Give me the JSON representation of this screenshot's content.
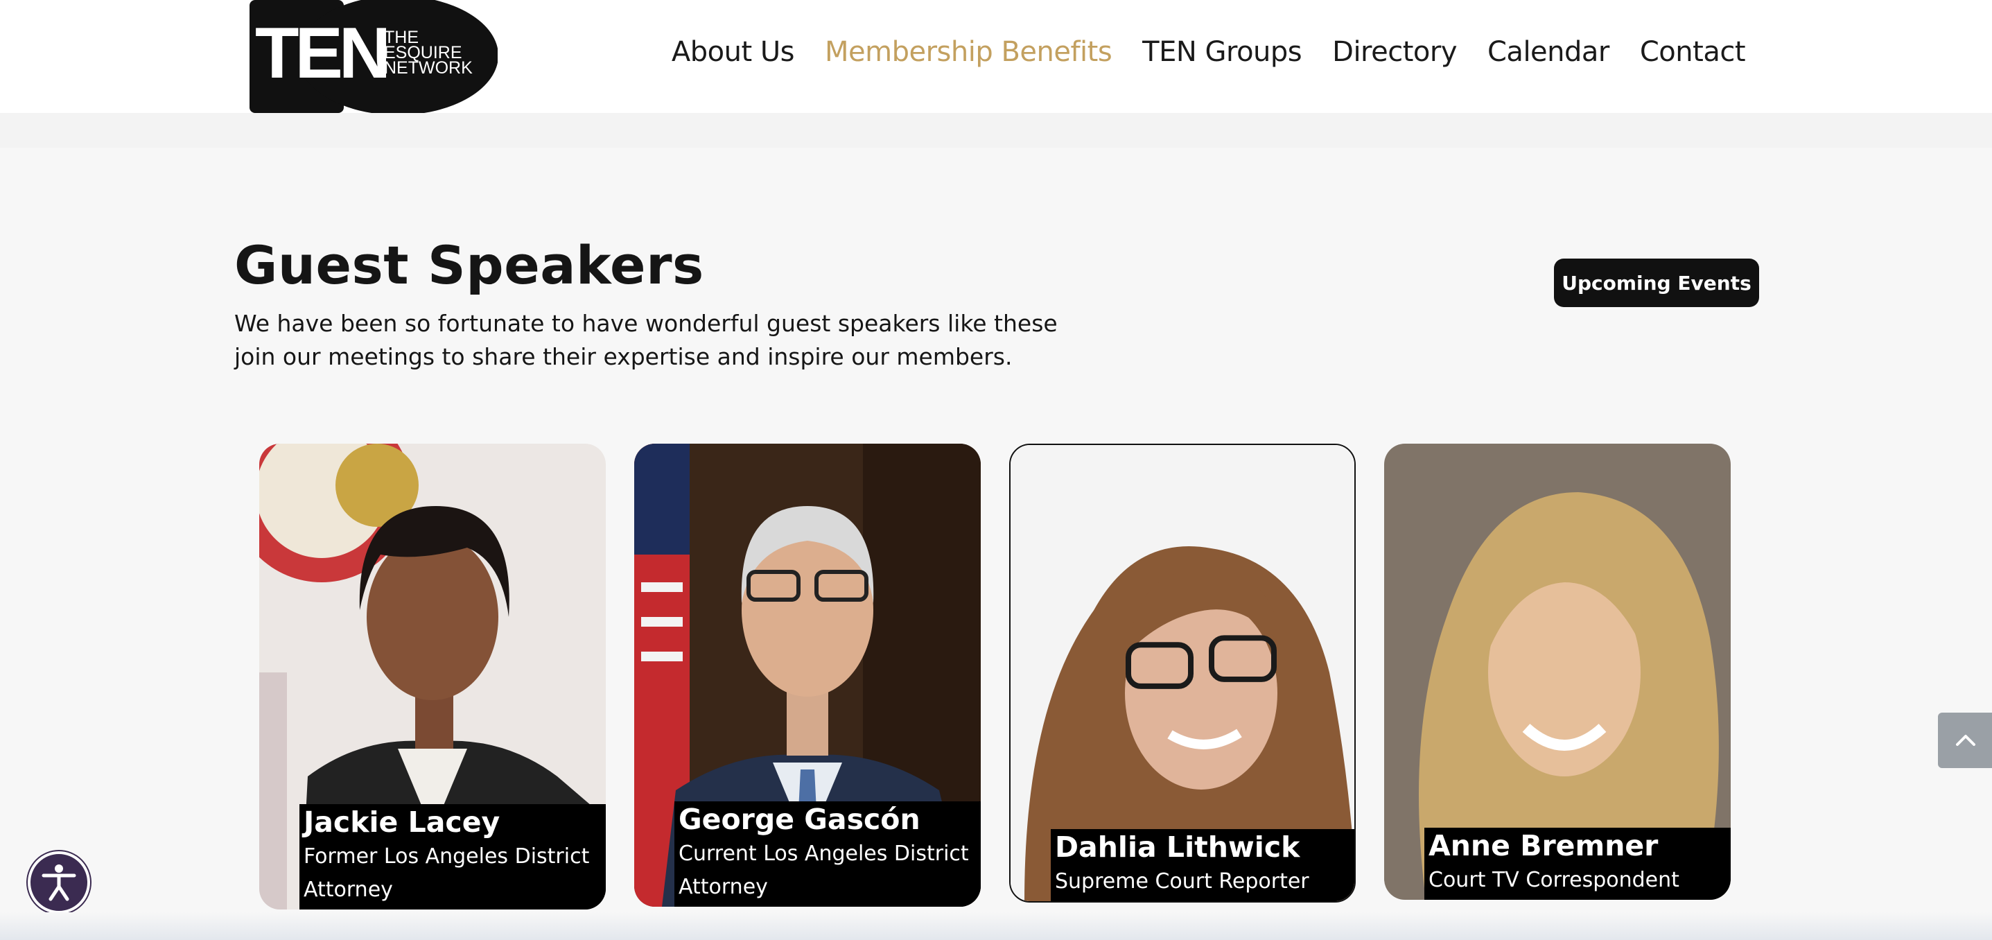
{
  "brand": {
    "logo_mark": "TEN",
    "logo_line1": "THE",
    "logo_line2": "ESQUIRE",
    "logo_line3": "NETWORK"
  },
  "nav": {
    "items": [
      {
        "label": "About Us",
        "active": false
      },
      {
        "label": "Membership Benefits",
        "active": true
      },
      {
        "label": "TEN Groups",
        "active": false
      },
      {
        "label": "Directory",
        "active": false
      },
      {
        "label": "Calendar",
        "active": false
      },
      {
        "label": "Contact",
        "active": false
      }
    ]
  },
  "section": {
    "title": "Guest Speakers",
    "intro_line1": "We have been so fortunate to have wonderful guest speakers like these",
    "intro_line2": "join our meetings to share their expertise and inspire our members.",
    "button_label": "Upcoming Events"
  },
  "speakers": [
    {
      "name": "Jackie Lacey",
      "role": "Former Los Angeles District Attorney"
    },
    {
      "name": "George Gascón",
      "role": "Current Los Angeles District Attorney"
    },
    {
      "name": "Dahlia Lithwick",
      "role": "Supreme Court Reporter"
    },
    {
      "name": "Anne Bremner",
      "role": "Court TV Correspondent"
    }
  ],
  "icons": {
    "accessibility": "accessibility-icon",
    "scroll_top": "chevron-up-icon"
  },
  "colors": {
    "accent": "#c3a05f",
    "button": "#111111",
    "accessibility": "#3b2b51"
  }
}
